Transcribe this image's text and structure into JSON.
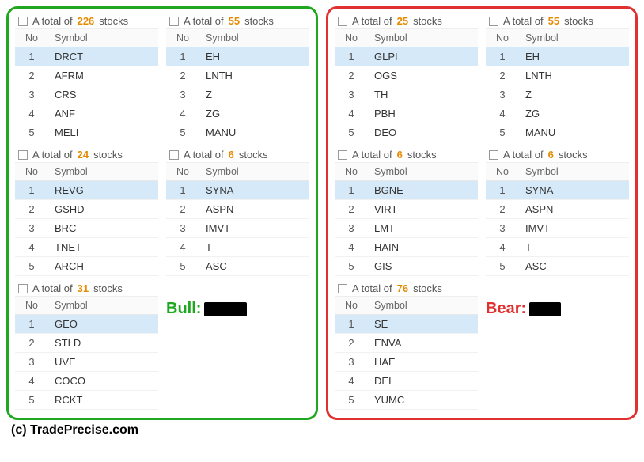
{
  "headers": {
    "no": "No",
    "symbol": "Symbol"
  },
  "total_prefix": "A total of ",
  "total_suffix": " stocks",
  "bull": {
    "label": "Bull:",
    "col1": [
      {
        "count": "226",
        "rows": [
          "DRCT",
          "AFRM",
          "CRS",
          "ANF",
          "MELI"
        ]
      },
      {
        "count": "24",
        "rows": [
          "REVG",
          "GSHD",
          "BRC",
          "TNET",
          "ARCH"
        ]
      },
      {
        "count": "31",
        "rows": [
          "GEO",
          "STLD",
          "UVE",
          "COCO",
          "RCKT"
        ]
      }
    ],
    "col2": [
      {
        "count": "55",
        "rows": [
          "EH",
          "LNTH",
          "Z",
          "ZG",
          "MANU"
        ]
      },
      {
        "count": "6",
        "rows": [
          "SYNA",
          "ASPN",
          "IMVT",
          "T",
          "ASC"
        ]
      }
    ]
  },
  "bear": {
    "label": "Bear:",
    "col1": [
      {
        "count": "25",
        "rows": [
          "GLPI",
          "OGS",
          "TH",
          "PBH",
          "DEO"
        ]
      },
      {
        "count": "6",
        "rows": [
          "BGNE",
          "VIRT",
          "LMT",
          "HAIN",
          "GIS"
        ]
      },
      {
        "count": "76",
        "rows": [
          "SE",
          "ENVA",
          "HAE",
          "DEI",
          "YUMC"
        ]
      }
    ],
    "col2": [
      {
        "count": "55",
        "rows": [
          "EH",
          "LNTH",
          "Z",
          "ZG",
          "MANU"
        ]
      },
      {
        "count": "6",
        "rows": [
          "SYNA",
          "ASPN",
          "IMVT",
          "T",
          "ASC"
        ]
      }
    ]
  },
  "copyright": "(c) TradePrecise.com"
}
